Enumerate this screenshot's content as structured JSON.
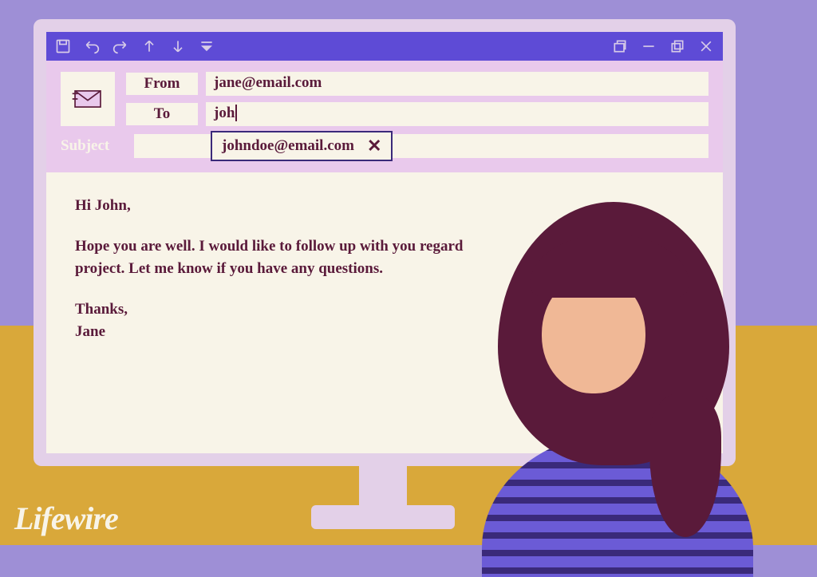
{
  "email": {
    "from_label": "From",
    "from_value": "jane@email.com",
    "to_label": "To",
    "to_value_partial": "joh",
    "subject_label": "Subject",
    "subject_value": "",
    "autocomplete_suggestion": "johndoe@email.com",
    "body": {
      "greeting": "Hi John,",
      "line1": "Hope you are well. I would like to follow up with you regard",
      "line2": "project. Let me know if you have any questions.",
      "signoff": "Thanks,",
      "signature": "Jane"
    }
  },
  "watermark": "Lifewire",
  "toolbar": {
    "icons_left": [
      "save",
      "undo",
      "redo",
      "up",
      "down",
      "dropdown"
    ],
    "icons_right": [
      "restore",
      "minimize",
      "maximize",
      "close"
    ]
  }
}
